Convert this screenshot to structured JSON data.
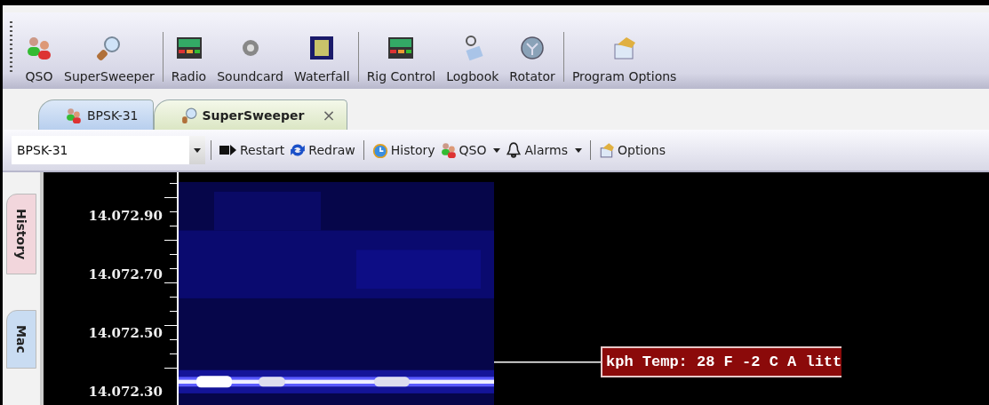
{
  "toolbar": {
    "groups": [
      [
        {
          "label": "QSO"
        },
        {
          "label": "SuperSweeper"
        }
      ],
      [
        {
          "label": "Radio"
        },
        {
          "label": "Soundcard"
        },
        {
          "label": "Waterfall"
        }
      ],
      [
        {
          "label": "Rig Control"
        },
        {
          "label": "Logbook"
        },
        {
          "label": "Rotator"
        }
      ],
      [
        {
          "label": "Program Options"
        }
      ]
    ]
  },
  "tabs": [
    {
      "label": "BPSK-31",
      "selected": false,
      "closable": false
    },
    {
      "label": "SuperSweeper",
      "selected": true,
      "closable": true,
      "close": "×"
    }
  ],
  "subtoolbar": {
    "mode_select": {
      "value": "BPSK-31"
    },
    "groups": [
      [
        {
          "label": "Restart",
          "dropdown": false
        },
        {
          "label": "Redraw",
          "dropdown": false
        }
      ],
      [
        {
          "label": "History",
          "dropdown": false
        },
        {
          "label": "QSO",
          "dropdown": true
        },
        {
          "label": "Alarms",
          "dropdown": true
        }
      ],
      [
        {
          "label": "Options",
          "dropdown": false
        }
      ]
    ]
  },
  "side_tabs": [
    {
      "label": "History",
      "color": "#f2d6dc"
    },
    {
      "label": "Mac",
      "color": "#c9dcf2"
    }
  ],
  "waterfall": {
    "freq_labels": [
      "14.072.90",
      "14.072.70",
      "14.072.50",
      "14.072.30"
    ],
    "decoded_label": "kph Temp: 28 F -2 C A litt"
  }
}
